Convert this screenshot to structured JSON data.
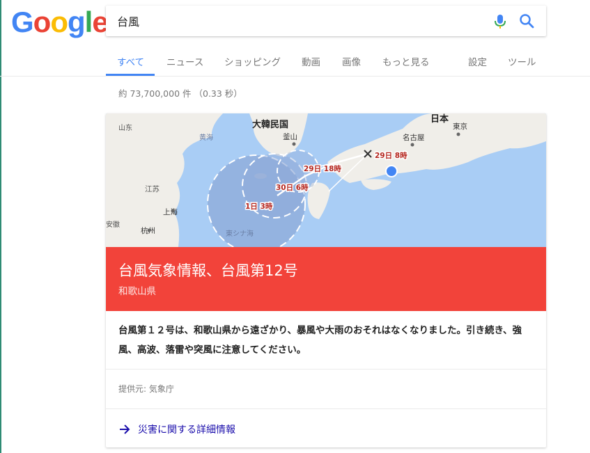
{
  "logo": {
    "letters": [
      "G",
      "o",
      "o",
      "g",
      "l",
      "e"
    ],
    "colors": [
      "#4285f4",
      "#ea4335",
      "#fbbc05",
      "#4285f4",
      "#34a853",
      "#ea4335"
    ]
  },
  "search": {
    "query": "台風"
  },
  "tabs": [
    {
      "label": "すべて",
      "active": true
    },
    {
      "label": "ニュース"
    },
    {
      "label": "ショッピング"
    },
    {
      "label": "動画"
    },
    {
      "label": "画像"
    },
    {
      "label": "もっと見る"
    },
    {
      "label": "設定"
    },
    {
      "label": "ツール"
    }
  ],
  "result_stats": "約 73,700,000 件 （0.33 秒）",
  "map": {
    "labels": {
      "japan": "日本",
      "korea": "大韓民国",
      "busan": "釜山",
      "yellow_sea": "黄海",
      "shandong": "山东",
      "jiangsu": "江苏",
      "shanghai": "上海",
      "anhui": "安徽",
      "hangzhou": "杭州",
      "east_china_sea": "東シナ海",
      "nagoya": "名古屋",
      "tokyo": "東京"
    },
    "forecast_points": [
      "29日 8時",
      "29日 18時",
      "30日 6時",
      "1日 3時"
    ],
    "colors": {
      "sea": "#a9cdf5",
      "land": "#f0eee9",
      "cone": "#8ea9d8",
      "track": "#ffffff",
      "forecast_text": "#b5261e",
      "position_dot": "#4285f4"
    }
  },
  "card": {
    "title": "台風気象情報、台風第12号",
    "subtitle": "和歌山県",
    "description": "台風第１２号は、和歌山県から遠ざかり、暴風や大雨のおそれはなくなりました。引き続き、強風、高波、落雷や突風に注意してください。",
    "source": "提供元: 気象庁",
    "more_link": "災害に関する詳細情報",
    "banner_color": "#f2433a"
  }
}
